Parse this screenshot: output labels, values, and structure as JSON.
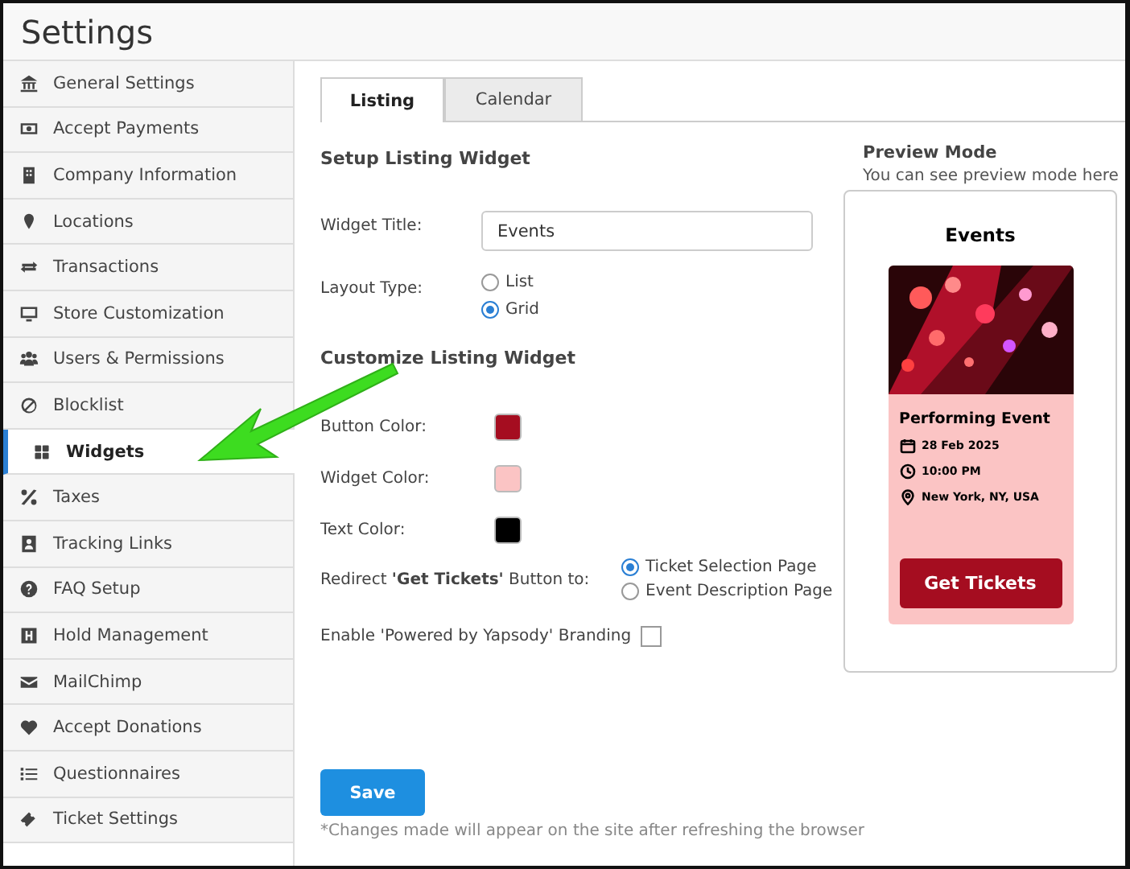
{
  "header": {
    "title": "Settings"
  },
  "sidebar": {
    "items": [
      {
        "label": "General Settings",
        "selected": false
      },
      {
        "label": "Accept Payments",
        "selected": false
      },
      {
        "label": "Company Information",
        "selected": false
      },
      {
        "label": "Locations",
        "selected": false
      },
      {
        "label": "Transactions",
        "selected": false
      },
      {
        "label": "Store Customization",
        "selected": false
      },
      {
        "label": "Users & Permissions",
        "selected": false
      },
      {
        "label": "Blocklist",
        "selected": false
      },
      {
        "label": "Widgets",
        "selected": true
      },
      {
        "label": "Taxes",
        "selected": false
      },
      {
        "label": "Tracking Links",
        "selected": false
      },
      {
        "label": "FAQ Setup",
        "selected": false
      },
      {
        "label": "Hold Management",
        "selected": false
      },
      {
        "label": "MailChimp",
        "selected": false
      },
      {
        "label": "Accept Donations",
        "selected": false
      },
      {
        "label": "Questionnaires",
        "selected": false
      },
      {
        "label": "Ticket Settings",
        "selected": false
      }
    ]
  },
  "tabs": [
    {
      "label": "Listing",
      "selected": true
    },
    {
      "label": "Calendar",
      "selected": false
    }
  ],
  "setup": {
    "heading": "Setup Listing Widget",
    "widget_title": {
      "label": "Widget Title:",
      "value": "Events"
    },
    "layout_type": {
      "label": "Layout Type:",
      "options": [
        {
          "label": "List",
          "selected": false
        },
        {
          "label": "Grid",
          "selected": true
        }
      ]
    }
  },
  "customize": {
    "heading": "Customize Listing Widget",
    "colors": [
      {
        "label": "Button Color:",
        "color": "#a50d20"
      },
      {
        "label": "Widget Color:",
        "color": "#fbc4c4"
      },
      {
        "label": "Text Color:",
        "color": "#000000"
      }
    ],
    "redirect": {
      "label": "Redirect **'Get Tickets'** Button to:",
      "options": [
        {
          "label": "Ticket Selection Page",
          "selected": true
        },
        {
          "label": "Event Description Page",
          "selected": false
        }
      ]
    },
    "branding": {
      "label": "Enable 'Powered by Yapsody' Branding",
      "checked": false
    }
  },
  "save_button": "Save",
  "note": "*Changes made will appear on the site after refreshing the browser",
  "preview": {
    "heading": "Preview Mode",
    "subtitle": "You can see preview mode here",
    "widget_title": "Events",
    "event": {
      "kind": "picture",
      "name": "Performing Event",
      "date": "28 Feb 2025",
      "time": "10:00 PM",
      "location": "New York, NY, USA",
      "button": "Get Tickets"
    }
  }
}
